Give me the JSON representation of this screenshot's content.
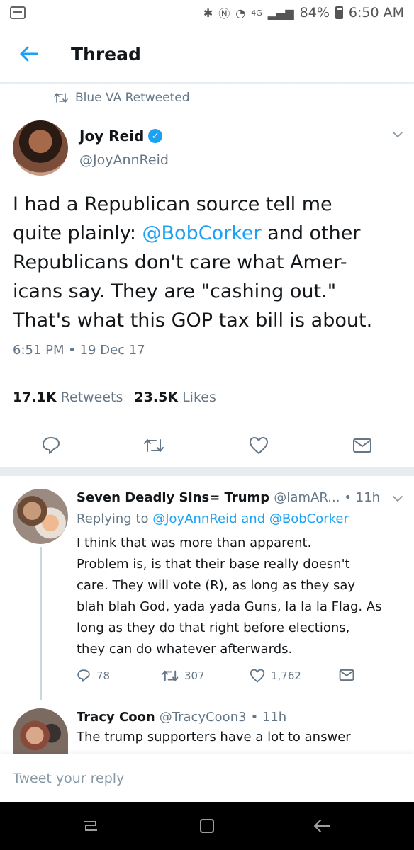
{
  "status_bar": {
    "network": "4G",
    "battery": "84%",
    "time": "6:50 AM"
  },
  "header": {
    "title": "Thread"
  },
  "retweet_context": "Blue VA Retweeted",
  "main_tweet": {
    "name": "Joy Reid",
    "handle": "@JoyAnnReid",
    "text_lines": [
      {
        "pre": "I had a Republican source tell me",
        "mention": "",
        "post": ""
      },
      {
        "pre": "quite plainly: ",
        "mention": "@BobCorker",
        "post": " and other"
      },
      {
        "pre": "Republicans don't care what Amer-",
        "mention": "",
        "post": ""
      },
      {
        "pre": "icans say. They are \"cashing out.\"",
        "mention": "",
        "post": ""
      },
      {
        "pre": "That's what this GOP tax bill is about.",
        "mention": "",
        "post": ""
      }
    ],
    "timestamp": "6:51 PM • 19 Dec 17",
    "retweets_count": "17.1K",
    "retweets_label": "Retweets",
    "likes_count": "23.5K",
    "likes_label": "Likes"
  },
  "replies": [
    {
      "name": "Seven Deadly Sins= Trump",
      "handle": "@IamAR...",
      "time": "• 11h",
      "replying_to_prefix": "Replying to",
      "replying_to_1": "@JoyAnnReid",
      "replying_to_and": "and",
      "replying_to_2": "@BobCorker",
      "text_lines": [
        "I think that was more than apparent.",
        "Problem is, is that their base really doesn't",
        "care. They will vote (R), as long as they say",
        "blah blah God, yada yada Guns, la la la Flag. As",
        "long as they do that right before elections,",
        "they can do whatever afterwards."
      ],
      "reply_count": "78",
      "retweet_count": "307",
      "like_count": "1,762"
    },
    {
      "name": "Tracy Coon",
      "handle": "@TracyCoon3",
      "time": "• 11h",
      "text_first_line": "The trump supporters have a lot to answer"
    }
  ],
  "composer": {
    "placeholder": "Tweet your reply"
  },
  "colors": {
    "accent": "#1da1f2",
    "muted": "#657786",
    "text": "#14171a"
  }
}
